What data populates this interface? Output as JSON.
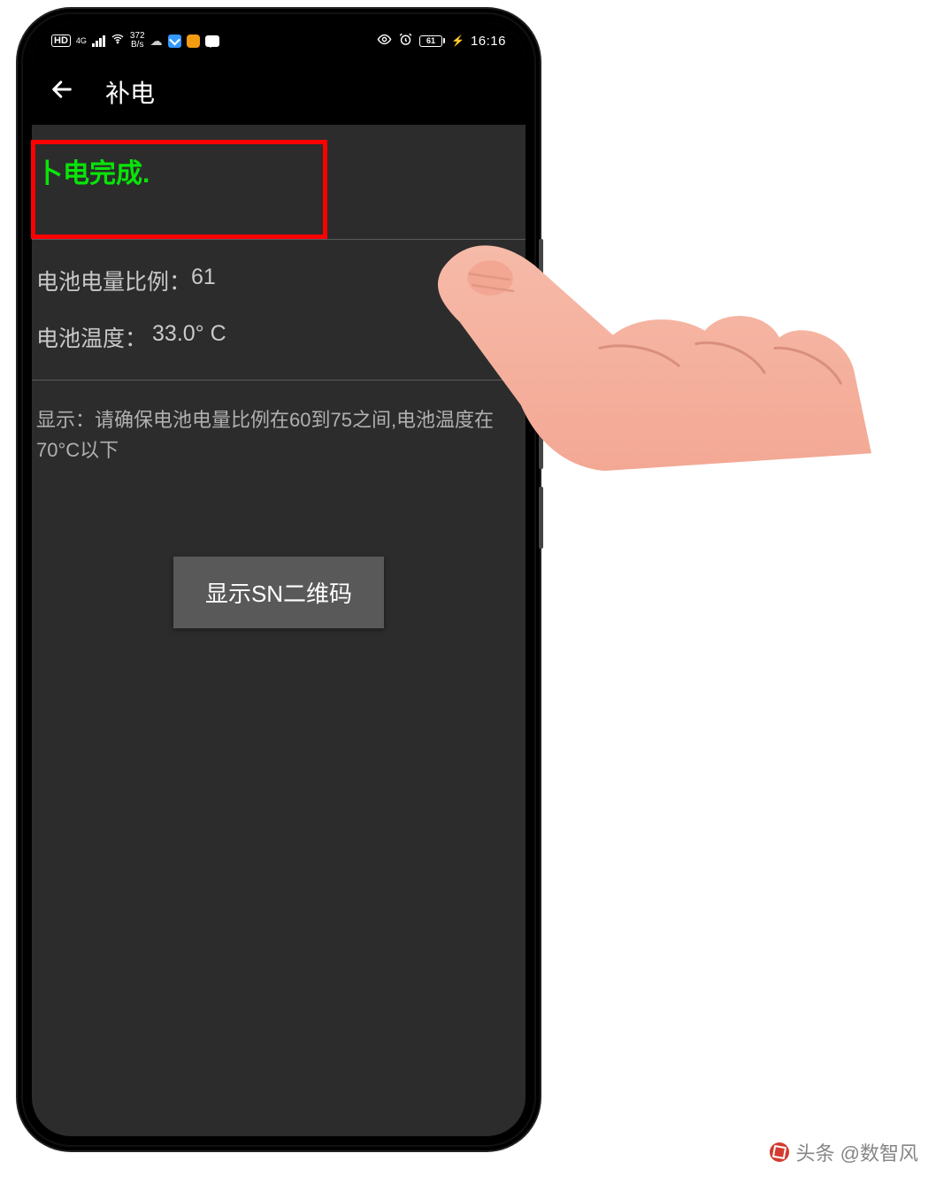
{
  "statusbar": {
    "hd": "HD",
    "net_gen": "4G",
    "speed_top": "372",
    "speed_bottom": "B/s",
    "battery_pct": "61",
    "clock": "16:16"
  },
  "titlebar": {
    "title": "补电"
  },
  "status": {
    "completion": "卜电完成."
  },
  "info": {
    "battery_ratio_label": "电池电量比例：",
    "battery_ratio_value": "61",
    "battery_temp_label": "电池温度：",
    "battery_temp_value": "33.0° C"
  },
  "hint": {
    "text": "显示：请确保电池电量比例在60到75之间,电池温度在70°C以下"
  },
  "button": {
    "sn_label": "显示SN二维码"
  },
  "watermark": {
    "text": "头条 @数智风"
  }
}
